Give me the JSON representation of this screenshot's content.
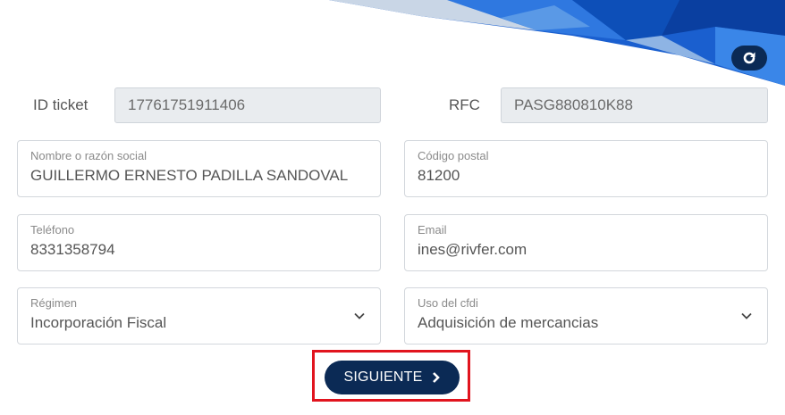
{
  "ticket": {
    "label": "ID ticket",
    "value": "17761751911406"
  },
  "rfc": {
    "label": "RFC",
    "value": "PASG880810K88"
  },
  "nombre": {
    "label": "Nombre o razón social",
    "value": "GUILLERMO ERNESTO PADILLA SANDOVAL"
  },
  "codigo_postal": {
    "label": "Código postal",
    "value": "81200"
  },
  "telefono": {
    "label": "Teléfono",
    "value": "8331358794"
  },
  "email": {
    "label": "Email",
    "value": "ines@rivfer.com"
  },
  "regimen": {
    "label": "Régimen",
    "value": "Incorporación Fiscal"
  },
  "uso_cfdi": {
    "label": "Uso del cfdi",
    "value": "Adquisición de mercancias"
  },
  "next_button": {
    "label": "SIGUIENTE"
  },
  "icons": {
    "refresh": "refresh-icon",
    "chevron": "chevron-down-icon",
    "next": "chevron-right-icon"
  },
  "colors": {
    "brand_dark": "#0b2a55",
    "brand_blue": "#1565c0",
    "highlight": "#e1141e"
  }
}
